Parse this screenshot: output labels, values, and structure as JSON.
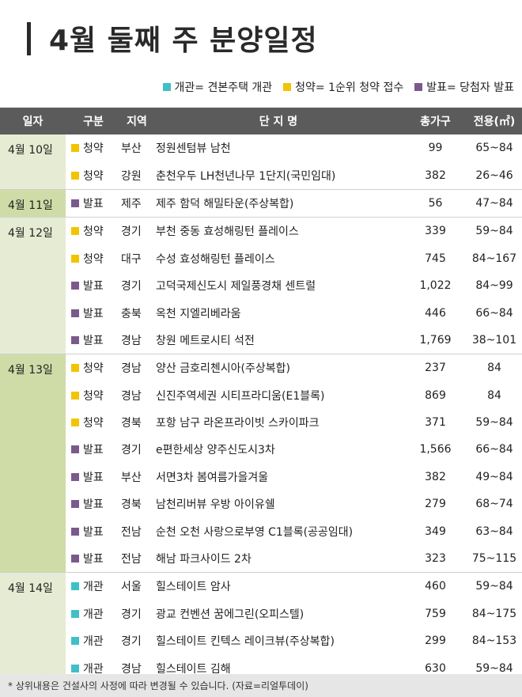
{
  "title": "4월 둘째 주 분양일정",
  "legend": [
    {
      "color": "#3fbfc8",
      "text": "개관= 견본주택 개관"
    },
    {
      "color": "#f2c400",
      "text": "청약= 1순위 청약 접수"
    },
    {
      "color": "#7a5a8c",
      "text": "발표= 당첨자 발표"
    }
  ],
  "colors": {
    "개관": "#3fbfc8",
    "청약": "#f2c400",
    "발표": "#7a5a8c"
  },
  "headers": {
    "date": "일자",
    "gubun": "구분",
    "region": "지역",
    "name": "단 지 명",
    "units": "총가구",
    "area": "전용(㎡)"
  },
  "groups": [
    {
      "date": "4월 10일",
      "rows": [
        {
          "type": "청약",
          "region": "부산",
          "name": "정원센텀뷰 남천",
          "units": "99",
          "area": "65~84"
        },
        {
          "type": "청약",
          "region": "강원",
          "name": "춘천우두 LH천년나무 1단지(국민임대)",
          "units": "382",
          "area": "26~46"
        }
      ]
    },
    {
      "date": "4월 11일",
      "dark": true,
      "rows": [
        {
          "type": "발표",
          "region": "제주",
          "name": "제주 함덕 해밀타운(주상복합)",
          "units": "56",
          "area": "47~84"
        }
      ]
    },
    {
      "date": "4월 12일",
      "rows": [
        {
          "type": "청약",
          "region": "경기",
          "name": "부천 중동 효성해링턴 플레이스",
          "units": "339",
          "area": "59~84"
        },
        {
          "type": "청약",
          "region": "대구",
          "name": "수성 효성해링턴 플레이스",
          "units": "745",
          "area": "84~167"
        },
        {
          "type": "발표",
          "region": "경기",
          "name": "고덕국제신도시 제일풍경채 센트럴",
          "units": "1,022",
          "area": "84~99"
        },
        {
          "type": "발표",
          "region": "충북",
          "name": "옥천 지엘리베라움",
          "units": "446",
          "area": "66~84"
        },
        {
          "type": "발표",
          "region": "경남",
          "name": "창원 메트로시티 석전",
          "units": "1,769",
          "area": "38~101"
        }
      ]
    },
    {
      "date": "4월 13일",
      "dark": true,
      "rows": [
        {
          "type": "청약",
          "region": "경남",
          "name": "양산 금호리첸시아(주상복합)",
          "units": "237",
          "area": "84"
        },
        {
          "type": "청약",
          "region": "경남",
          "name": "신진주역세권 시티프라디움(E1블록)",
          "units": "869",
          "area": "84"
        },
        {
          "type": "청약",
          "region": "경북",
          "name": "포항 남구 라온프라이빗 스카이파크",
          "units": "371",
          "area": "59~84"
        },
        {
          "type": "발표",
          "region": "경기",
          "name": "e편한세상 양주신도시3차",
          "units": "1,566",
          "area": "66~84"
        },
        {
          "type": "발표",
          "region": "부산",
          "name": "서면3차 봄여름가을겨울",
          "units": "382",
          "area": "49~84"
        },
        {
          "type": "발표",
          "region": "경북",
          "name": "남천리버뷰 우방 아이유쉘",
          "units": "279",
          "area": "68~74"
        },
        {
          "type": "발표",
          "region": "전남",
          "name": "순천 오천 사랑으로부영 C1블록(공공임대)",
          "units": "349",
          "area": "63~84"
        },
        {
          "type": "발표",
          "region": "전남",
          "name": "해남 파크사이드 2차",
          "units": "323",
          "area": "75~115"
        }
      ]
    },
    {
      "date": "4월 14일",
      "rows": [
        {
          "type": "개관",
          "region": "서울",
          "name": "힐스테이트 암사",
          "units": "460",
          "area": "59~84"
        },
        {
          "type": "개관",
          "region": "경기",
          "name": "광교 컨벤션 꿈에그린(오피스텔)",
          "units": "759",
          "area": "84~175"
        },
        {
          "type": "개관",
          "region": "경기",
          "name": "힐스테이트 킨텍스 레이크뷰(주상복합)",
          "units": "299",
          "area": "84~153"
        },
        {
          "type": "개관",
          "region": "경남",
          "name": "힐스테이트 김해",
          "units": "630",
          "area": "59~84"
        }
      ]
    }
  ],
  "footnote": "* 상위내용은 건설사의 사정에 따라 변경될 수 있습니다. (자료=리얼투데이)"
}
